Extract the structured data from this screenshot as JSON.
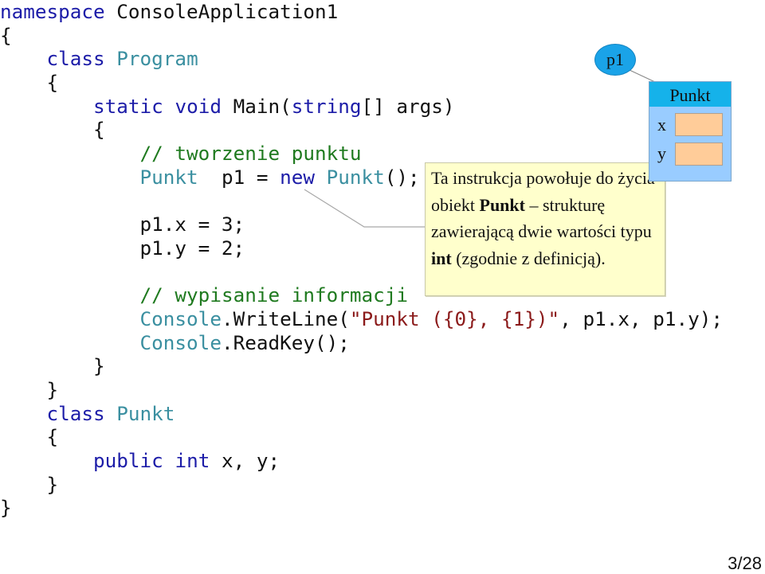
{
  "slide": {
    "page_number": "3/28"
  },
  "code": {
    "language": "C#",
    "lines": [
      [
        {
          "t": "namespace ",
          "c": "kw"
        },
        {
          "t": "ConsoleApplication1",
          "c": "tx"
        }
      ],
      [
        {
          "t": "{",
          "c": "tx"
        }
      ],
      [
        {
          "t": "  ",
          "c": "tx"
        },
        {
          "t": "class ",
          "c": "kw"
        },
        {
          "t": "Program",
          "c": "ty"
        }
      ],
      [
        {
          "t": "  {",
          "c": "tx"
        }
      ],
      [
        {
          "t": "    ",
          "c": "tx"
        },
        {
          "t": "static ",
          "c": "kw"
        },
        {
          "t": "void ",
          "c": "kw"
        },
        {
          "t": "Main(",
          "c": "tx"
        },
        {
          "t": "string",
          "c": "kw"
        },
        {
          "t": "[] args)",
          "c": "tx"
        }
      ],
      [
        {
          "t": "    {",
          "c": "tx"
        }
      ],
      [
        {
          "t": "      ",
          "c": "tx"
        },
        {
          "t": "// tworzenie punktu",
          "c": "cm"
        }
      ],
      [
        {
          "t": "      ",
          "c": "tx"
        },
        {
          "t": "Punkt",
          "c": "ty"
        },
        {
          "t": " p1 = ",
          "c": "tx"
        },
        {
          "t": "new ",
          "c": "kw"
        },
        {
          "t": "Punkt",
          "c": "ty"
        },
        {
          "t": "();",
          "c": "tx"
        }
      ],
      [
        {
          "t": "",
          "c": "tx"
        }
      ],
      [
        {
          "t": "      p1.x = 3;",
          "c": "tx"
        }
      ],
      [
        {
          "t": "      p1.y = 2;",
          "c": "tx"
        }
      ],
      [
        {
          "t": "",
          "c": "tx"
        }
      ],
      [
        {
          "t": "      ",
          "c": "tx"
        },
        {
          "t": "// wypisanie informacji",
          "c": "cm"
        }
      ],
      [
        {
          "t": "      ",
          "c": "tx"
        },
        {
          "t": "Console",
          "c": "ty"
        },
        {
          "t": ".WriteLine(",
          "c": "tx"
        },
        {
          "t": "\"Punkt ({0}, {1})\"",
          "c": "st"
        },
        {
          "t": ", p1.x, p1.y);",
          "c": "tx"
        }
      ],
      [
        {
          "t": "      ",
          "c": "tx"
        },
        {
          "t": "Console",
          "c": "ty"
        },
        {
          "t": ".ReadKey();",
          "c": "tx"
        }
      ],
      [
        {
          "t": "    }",
          "c": "tx"
        }
      ],
      [
        {
          "t": "  }",
          "c": "tx"
        }
      ],
      [
        {
          "t": "  ",
          "c": "tx"
        },
        {
          "t": "class ",
          "c": "kw"
        },
        {
          "t": "Punkt",
          "c": "ty"
        }
      ],
      [
        {
          "t": "  {",
          "c": "tx"
        }
      ],
      [
        {
          "t": "    ",
          "c": "tx"
        },
        {
          "t": "public ",
          "c": "kw"
        },
        {
          "t": "int ",
          "c": "kw"
        },
        {
          "t": "x, y;",
          "c": "tx"
        }
      ],
      [
        {
          "t": "  }",
          "c": "tx"
        }
      ],
      [
        {
          "t": "}",
          "c": "tx"
        }
      ]
    ]
  },
  "callout": {
    "segments": [
      {
        "t": "Ta instrukcja powołuje do życia obiekt ",
        "b": false
      },
      {
        "t": "Punkt",
        "b": true
      },
      {
        "t": " – strukturę zawierającą dwie wartości typu ",
        "b": false
      },
      {
        "t": "int",
        "b": true
      },
      {
        "t": " (zgodnie z definicją).",
        "b": false
      }
    ]
  },
  "diagram": {
    "reference_label": "p1",
    "object_type": "Punkt",
    "fields": [
      {
        "name": "x",
        "value": ""
      },
      {
        "name": "y",
        "value": ""
      }
    ],
    "colors": {
      "reference": "#1aa3e8",
      "header": "#15b2ea",
      "body": "#99ccff",
      "field": "#ffcc99",
      "callout": "#ffffcc"
    }
  }
}
